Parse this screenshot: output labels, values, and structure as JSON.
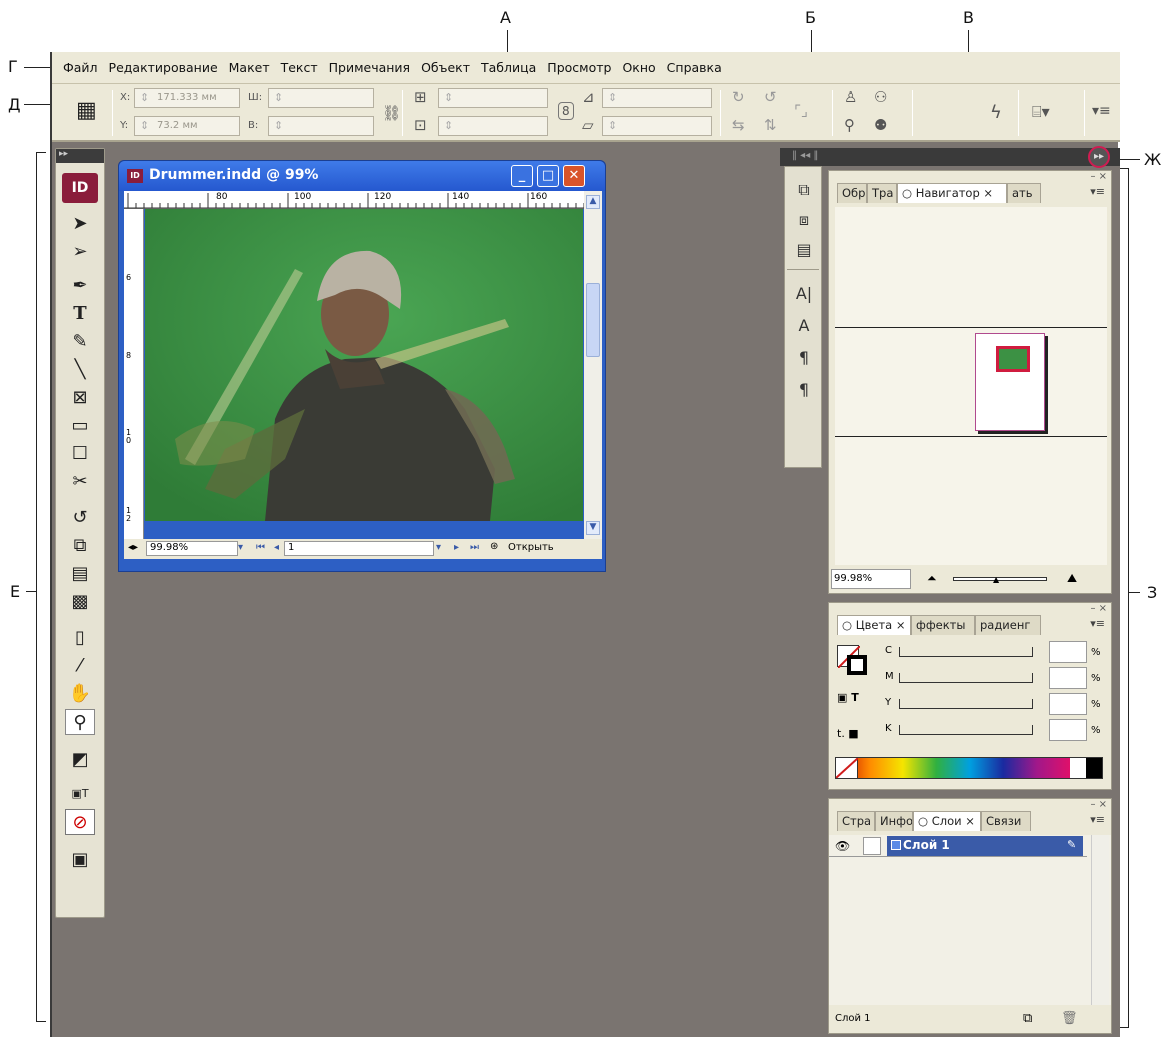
{
  "callouts": {
    "a": "А",
    "b": "Б",
    "v": "В",
    "g": "Г",
    "d": "Д",
    "e": "Е",
    "zh": "Ж",
    "z": "З"
  },
  "menu": [
    "Файл",
    "Редактирование",
    "Макет",
    "Текст",
    "Примечания",
    "Объект",
    "Таблица",
    "Просмотр",
    "Окно",
    "Справка"
  ],
  "control": {
    "x_label": "X:",
    "x_value": "171.333 мм",
    "y_label": "Y:",
    "y_value": "73.2 мм",
    "w_label": "Ш:",
    "h_label": "В:"
  },
  "tools": {
    "logo": "ID"
  },
  "document": {
    "title": "Drummer.indd @ 99%",
    "ruler_ticks": [
      "80",
      "100",
      "120",
      "140",
      "160"
    ],
    "left_ruler": [
      "6",
      "8",
      "1\n0",
      "1\n2"
    ],
    "zoom": "99.98%",
    "page": "1",
    "open": "Открыть"
  },
  "navigator": {
    "tabs": [
      "Обр",
      "Тра",
      "Навигатор",
      "ать"
    ],
    "zoom": "99.98%"
  },
  "colors": {
    "tabs": [
      "Цвета",
      "ффекты",
      "радиенг"
    ],
    "rows": [
      "C",
      "M",
      "Y",
      "K"
    ],
    "unit": "%"
  },
  "layers": {
    "tabs": [
      "Стра",
      "Инфо",
      "Слои",
      "Связи"
    ],
    "layer_name": "Слой 1",
    "footer": "Слой 1"
  }
}
